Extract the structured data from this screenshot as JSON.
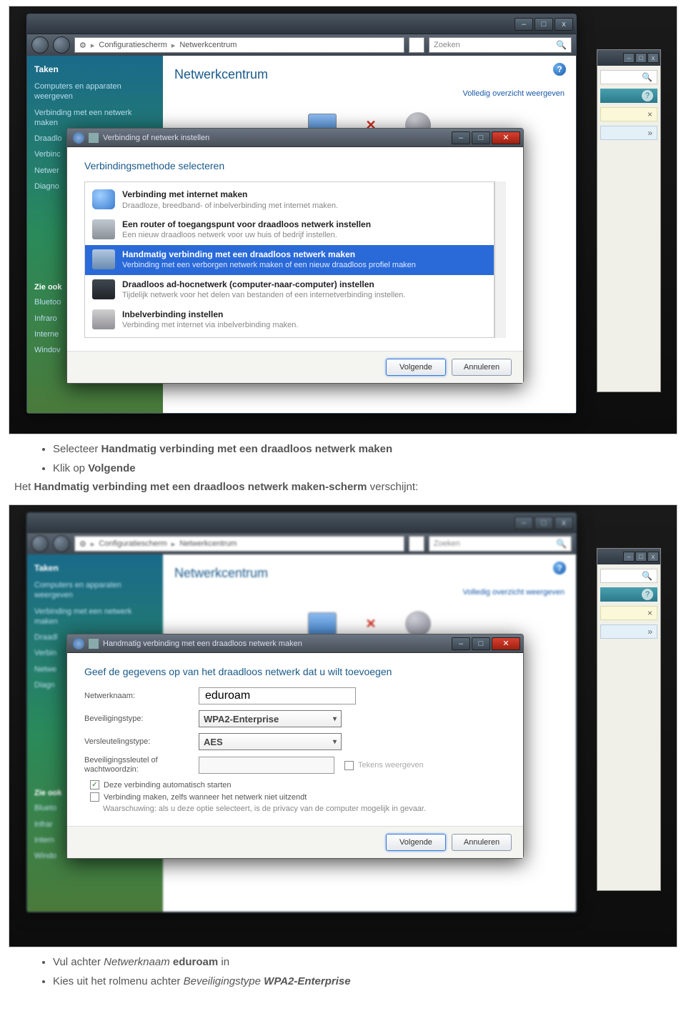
{
  "screenshot1": {
    "back_window": {
      "breadcrumb": [
        "Configuratiescherm",
        "Netwerkcentrum"
      ],
      "search_placeholder": "Zoeken",
      "sidebar": {
        "heading": "Taken",
        "items": [
          "Computers en apparaten weergeven",
          "Verbinding met een netwerk maken",
          "Draadlo",
          "Verbinc",
          "Netwer",
          "Diagno"
        ],
        "also_heading": "Zie ook",
        "also_items": [
          "Bluetoo",
          "Infraro",
          "Interne",
          "Windov"
        ]
      },
      "main_title": "Netwerkcentrum",
      "full_overview": "Volledig overzicht weergeven"
    },
    "dialog": {
      "title": "Verbinding of netwerk instellen",
      "heading": "Verbindingsmethode selecteren",
      "options": [
        {
          "title": "Verbinding met internet maken",
          "sub": "Draadloze, breedband- of inbelverbinding met internet maken."
        },
        {
          "title": "Een router of toegangspunt voor draadloos netwerk instellen",
          "sub": "Een nieuw draadloos netwerk voor uw huis of bedrijf instellen."
        },
        {
          "title": "Handmatig verbinding met een draadloos netwerk maken",
          "sub": "Verbinding met een verborgen netwerk maken of een nieuw draadloos profiel maken"
        },
        {
          "title": "Draadloos ad-hocnetwerk (computer-naar-computer) instellen",
          "sub": "Tijdelijk netwerk voor het delen van bestanden of een internetverbinding instellen."
        },
        {
          "title": "Inbelverbinding instellen",
          "sub": "Verbinding met internet via inbelverbinding maken."
        }
      ],
      "next": "Volgende",
      "cancel": "Annuleren"
    }
  },
  "instructions1": {
    "b1_pre": "Selecteer ",
    "b1_bold": "Handmatig verbinding met een draadloos netwerk maken",
    "b2_pre": "Klik op ",
    "b2_bold": "Volgende",
    "line_pre": "Het ",
    "line_bold": "Handmatig verbinding met een draadloos netwerk maken-scherm",
    "line_post": " verschijnt:"
  },
  "screenshot2": {
    "back_window": {
      "breadcrumb": [
        "Configuratiescherm",
        "Netwerkcentrum"
      ],
      "search_placeholder": "Zoeken",
      "sidebar": {
        "heading": "Taken",
        "items": [
          "Computers en apparaten weergeven",
          "Verbinding met een netwerk maken",
          "Draadl",
          "Verbin",
          "Netwe",
          "Diagn"
        ],
        "also_heading": "Zie ook",
        "also_items": [
          "Blueto",
          "Infrar",
          "Intern",
          "Windo"
        ]
      },
      "main_title": "Netwerkcentrum",
      "full_overview": "Volledig overzicht weergeven"
    },
    "dialog": {
      "title": "Handmatig verbinding met een draadloos netwerk maken",
      "heading": "Geef de gegevens op van het draadloos netwerk dat u wilt toevoegen",
      "labels": {
        "name": "Netwerknaam:",
        "sectype": "Beveiligingstype:",
        "enctype": "Versleutelingstype:",
        "key": "Beveiligingssleutel of wachtwoordzin:"
      },
      "values": {
        "name": "eduroam",
        "sectype": "WPA2-Enterprise",
        "enctype": "AES"
      },
      "show_chars": "Tekens weergeven",
      "auto_start": "Deze verbinding automatisch starten",
      "connect_hidden": "Verbinding maken, zelfs wanneer het netwerk niet uitzendt",
      "warning": "Waarschuwing: als u deze optie selecteert, is de privacy van de computer mogelijk in gevaar.",
      "next": "Volgende",
      "cancel": "Annuleren"
    }
  },
  "instructions2": {
    "b1_pre": "Vul achter ",
    "b1_italic": "Netwerknaam ",
    "b1_bold": "eduroam",
    "b1_post": " in",
    "b2_pre": "Kies uit het rolmenu achter ",
    "b2_italic": "Beveiligingstype ",
    "b2_bold": "WPA2-Enterprise"
  }
}
